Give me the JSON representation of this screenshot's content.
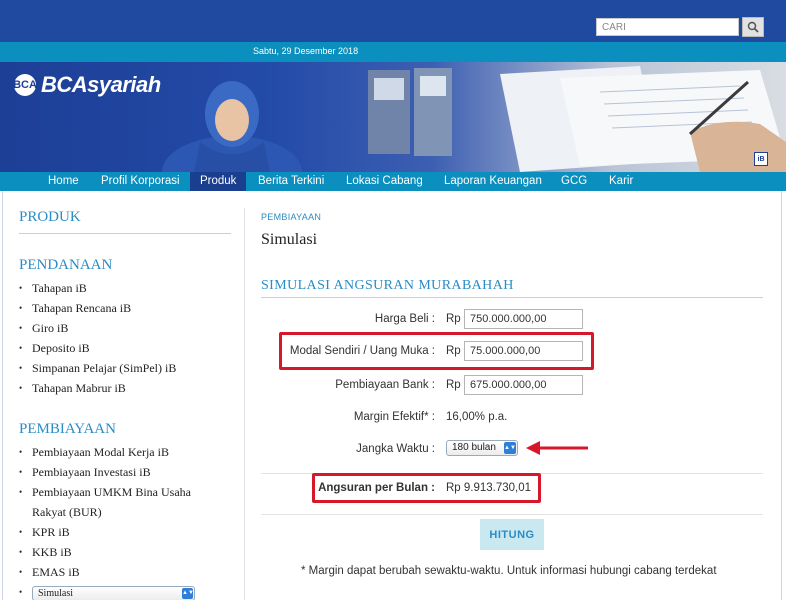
{
  "header": {
    "search_placeholder": "CARI",
    "date": "Sabtu, 29 Desember 2018",
    "logo_mark": "BCA",
    "logo_text": "BCAsyariah",
    "ib_badge": "iB"
  },
  "nav": {
    "items": [
      "Home",
      "Profil Korporasi",
      "Produk",
      "Berita Terkini",
      "Lokasi Cabang",
      "Laporan Keuangan",
      "GCG",
      "Karir"
    ],
    "active": "Produk"
  },
  "sidebar": {
    "title": "PRODUK",
    "pendanaan_title": "PENDANAAN",
    "pendanaan_items": [
      "Tahapan iB",
      "Tahapan Rencana iB",
      "Giro iB",
      "Deposito iB",
      "Simpanan Pelajar (SimPel) iB",
      "Tahapan Mabrur iB"
    ],
    "pembiayaan_title": "PEMBIAYAAN",
    "pembiayaan_items": [
      "Pembiayaan Modal Kerja iB",
      "Pembiayaan Investasi iB",
      "Pembiayaan UMKM Bina Usaha Rakyat (BUR)",
      "KPR iB",
      "KKB iB",
      "EMAS iB"
    ],
    "select_value": "Simulasi"
  },
  "main": {
    "breadcrumb": "PEMBIAYAAN",
    "page_title": "Simulasi",
    "section_title": "SIMULASI ANGSURAN MURABAHAH",
    "currency": "Rp",
    "harga_beli_label": "Harga Beli :",
    "harga_beli_value": "750.000.000,00",
    "modal_label": "Modal Sendiri / Uang Muka :",
    "modal_value": "75.000.000,00",
    "pembiayaan_label": "Pembiayaan Bank :",
    "pembiayaan_value": "675.000.000,00",
    "margin_label": "Margin Efektif* :",
    "margin_value": "16,00% p.a.",
    "jangka_label": "Jangka Waktu :",
    "jangka_value": "180 bulan",
    "angsuran_label": "Angsuran per Bulan :",
    "angsuran_value": "Rp 9.913.730,01",
    "button_label": "HITUNG",
    "note": "* Margin dapat berubah sewaktu-waktu. Untuk informasi hubungi cabang terdekat"
  },
  "colors": {
    "header_blue": "#1f4aa0",
    "nav_teal": "#0b8fbf",
    "accent_blue": "#2a8cc6",
    "annotation_red": "#d6192a"
  }
}
